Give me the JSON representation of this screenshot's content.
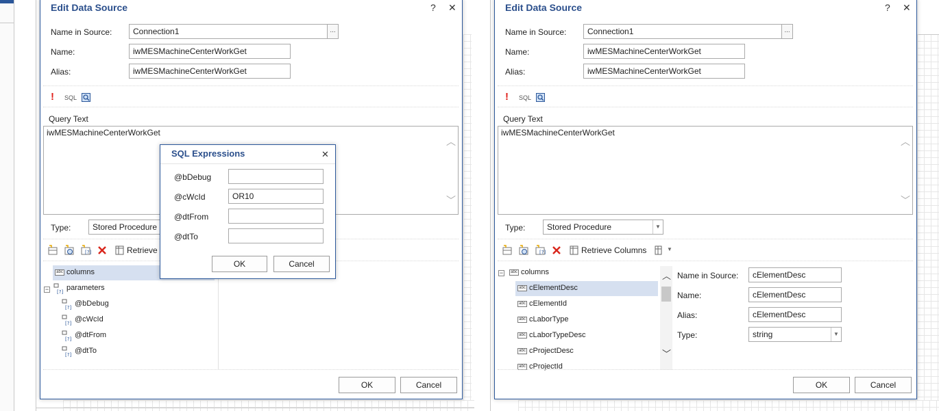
{
  "colors": {
    "accent": "#2b579a",
    "title": "#2b4f8c",
    "selection": "#d6e0f0",
    "error": "#e0201b"
  },
  "left_dialog": {
    "title": "Edit Data Source",
    "help": "?",
    "close": "✕",
    "name_in_source_label": "Name in Source:",
    "name_in_source_value": "Connection1",
    "browse": "...",
    "name_label": "Name:",
    "name_value": "iwMESMachineCenterWorkGet",
    "alias_label": "Alias:",
    "alias_value": "iwMESMachineCenterWorkGet",
    "toolbar": {
      "error_icon": "!",
      "sql_label": "SQL"
    },
    "query_text_label": "Query Text",
    "query_text": "iwMESMachineCenterWorkGet",
    "type_label": "Type:",
    "type_value": "Stored Procedure",
    "retrieve_label": "Retrieve",
    "tree": {
      "columns": "columns",
      "parameters": "parameters",
      "params": [
        "@bDebug",
        "@cWcId",
        "@dtFrom",
        "@dtTo"
      ]
    },
    "ok": "OK",
    "cancel": "Cancel"
  },
  "sql_expressions": {
    "title": "SQL Expressions",
    "close": "✕",
    "rows": [
      {
        "label": "@bDebug",
        "value": ""
      },
      {
        "label": "@cWcId",
        "value": "OR10"
      },
      {
        "label": "@dtFrom",
        "value": ""
      },
      {
        "label": "@dtTo",
        "value": ""
      }
    ],
    "ok": "OK",
    "cancel": "Cancel"
  },
  "right_dialog": {
    "title": "Edit Data Source",
    "help": "?",
    "close": "✕",
    "name_in_source_label": "Name in Source:",
    "name_in_source_value": "Connection1",
    "browse": "...",
    "name_label": "Name:",
    "name_value": "iwMESMachineCenterWorkGet",
    "alias_label": "Alias:",
    "alias_value": "iwMESMachineCenterWorkGet",
    "toolbar": {
      "error_icon": "!",
      "sql_label": "SQL"
    },
    "query_text_label": "Query Text",
    "query_text": "iwMESMachineCenterWorkGet",
    "type_label": "Type:",
    "type_value": "Stored Procedure",
    "retrieve_label": "Retrieve Columns",
    "tree": {
      "columns": "columns",
      "items": [
        "cElementDesc",
        "cElementId",
        "cLaborType",
        "cLaborTypeDesc",
        "cProjectDesc",
        "cProjectId"
      ]
    },
    "props": {
      "name_in_source_label": "Name in Source:",
      "name_in_source_value": "cElementDesc",
      "name_label": "Name:",
      "name_value": "cElementDesc",
      "alias_label": "Alias:",
      "alias_value": "cElementDesc",
      "type_label": "Type:",
      "type_value": "string"
    },
    "ok": "OK",
    "cancel": "Cancel"
  }
}
